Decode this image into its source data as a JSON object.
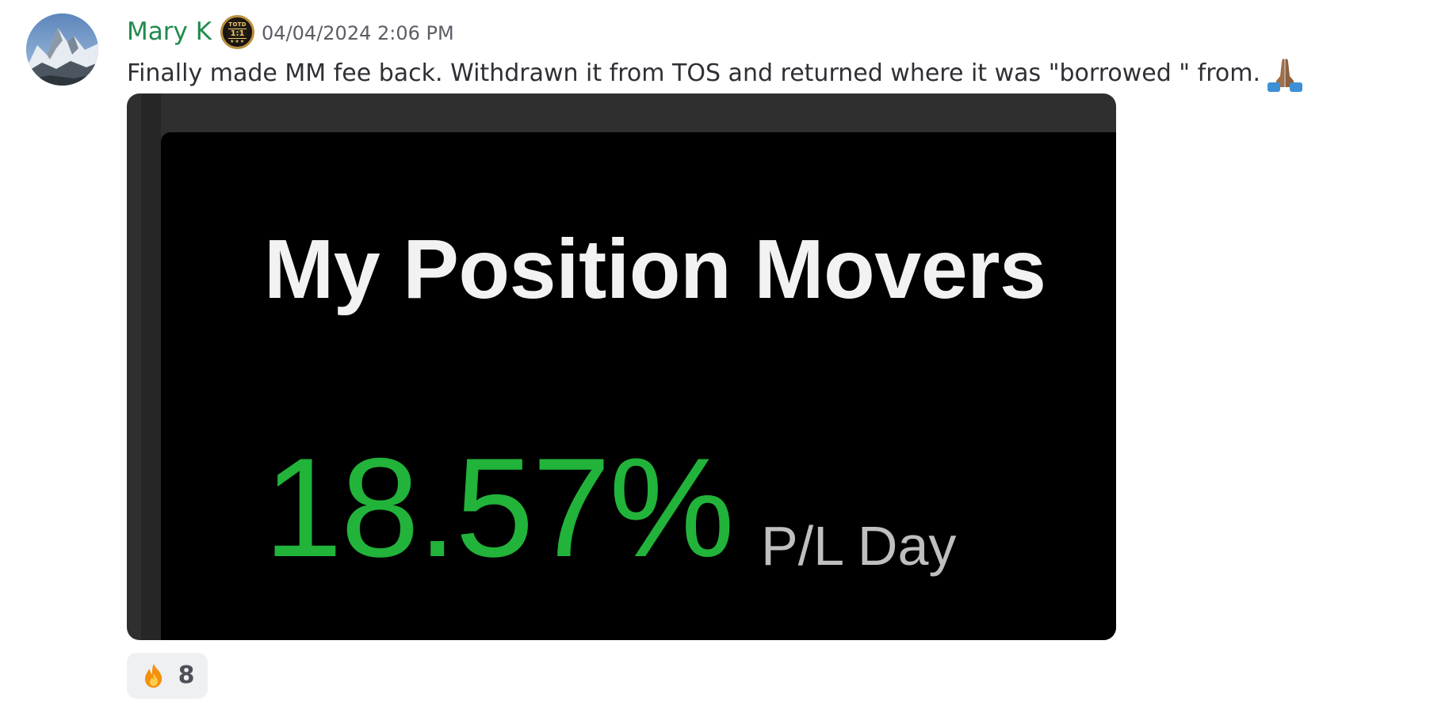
{
  "message": {
    "author": "Mary K",
    "role_badge": {
      "top": "TOTD",
      "middle": "1:1",
      "stars": "★★★"
    },
    "timestamp": "04/04/2024 2:06 PM",
    "text": "Finally made MM fee back. Withdrawn it from TOS and returned where it was \"borrowed \" from.",
    "trailing_emoji": "folded-hands",
    "author_color": "#1f8b4c"
  },
  "attachment": {
    "title": "My Position Movers",
    "percent": "18.57%",
    "label": "P/L Day",
    "percent_color": "#22b33a"
  },
  "reactions": [
    {
      "emoji": "fire",
      "count": "8"
    }
  ]
}
